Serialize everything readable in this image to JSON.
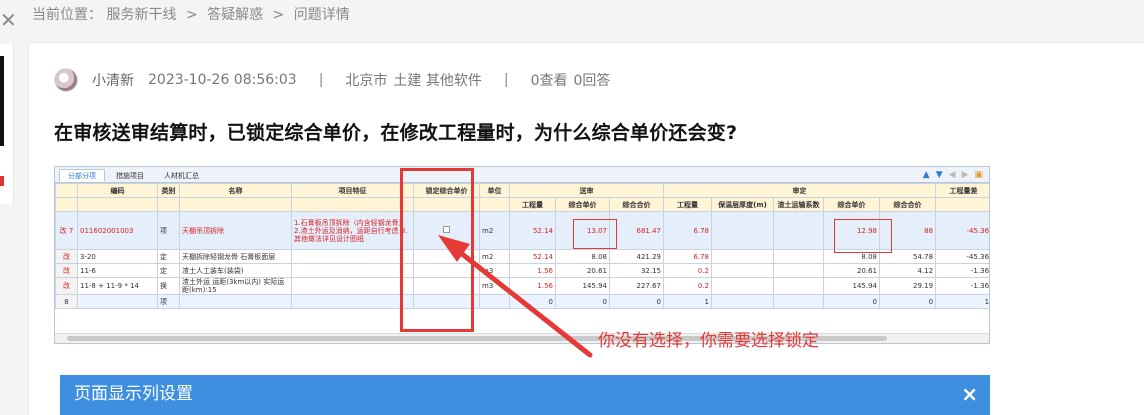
{
  "breadcrumb": {
    "prefix": "当前位置：",
    "items": [
      "服务新干线",
      "答疑解惑",
      "问题详情"
    ],
    "separator": ">"
  },
  "post": {
    "author": "小清新",
    "datetime": "2023-10-26 08:56:03",
    "location": "北京市",
    "category": "土建 其他软件",
    "views": "0查看",
    "answers": "0回答",
    "title": "在审核送审结算时，已锁定综合单价，在修改工程量时，为什么综合单价还会变?"
  },
  "screenshot": {
    "tabs": [
      "分部分项",
      "措施项目",
      "人材机汇总"
    ],
    "headers": {
      "code": "编码",
      "type": "类别",
      "name": "名称",
      "feature": "项目特征",
      "lock": "锁定综合单价",
      "unit": "单位",
      "submit_group": "送审",
      "review_group": "审定",
      "qty": "工程量",
      "unit_price": "综合单价",
      "total": "综合合价",
      "thickness": "保温层厚度(m)",
      "coef": "渣土运输系数",
      "diff": "工程量差"
    },
    "rows": [
      {
        "idx": "改 7",
        "code": "011602001003",
        "type": "项",
        "name": "天棚吊顶拆除",
        "feature": "1.石膏板吊顶拆除（内含轻钢龙骨）2.渣土外运及消纳，运距自行考虑 3.其他做法详见设计图纸",
        "unit": "m2",
        "s_qty": "52.14",
        "s_price": "13.07",
        "s_total": "681.47",
        "r_qty": "6.78",
        "r_thick": "",
        "r_coef": "",
        "r_price": "12.98",
        "r_total": "88",
        "diff": "-45.36"
      },
      {
        "idx": "改",
        "code": "3-20",
        "type": "定",
        "name": "天棚拆除轻钢龙骨 石膏板面层",
        "feature": "",
        "unit": "m2",
        "s_qty": "52.14",
        "s_price": "8.08",
        "s_total": "421.29",
        "r_qty": "6.78",
        "r_thick": "",
        "r_coef": "",
        "r_price": "8.08",
        "r_total": "54.78",
        "diff": "-45.36"
      },
      {
        "idx": "改",
        "code": "11-6",
        "type": "定",
        "name": "渣土人工装车(装袋)",
        "feature": "",
        "unit": "m3",
        "s_qty": "1.56",
        "s_price": "20.61",
        "s_total": "32.15",
        "r_qty": "0.2",
        "r_thick": "",
        "r_coef": "",
        "r_price": "20.61",
        "r_total": "4.12",
        "diff": "-1.36"
      },
      {
        "idx": "改",
        "code": "11-8 + 11-9 * 14",
        "type": "换",
        "name": "渣土外运 运距(3km以内) 实际运距(km):15",
        "feature": "",
        "unit": "m3",
        "s_qty": "1.56",
        "s_price": "145.94",
        "s_total": "227.67",
        "r_qty": "0.2",
        "r_thick": "",
        "r_coef": "",
        "r_price": "145.94",
        "r_total": "29.19",
        "diff": "-1.36"
      },
      {
        "idx": "8",
        "code": "",
        "type": "项",
        "name": "",
        "feature": "",
        "unit": "",
        "s_qty": "0",
        "s_price": "0",
        "s_total": "0",
        "r_qty": "1",
        "r_thick": "",
        "r_coef": "",
        "r_price": "0",
        "r_total": "0",
        "diff": "1"
      }
    ]
  },
  "annotation": {
    "note": "你没有选择，你需要选择锁定",
    "color": "#e53935"
  },
  "dialog": {
    "title": "页面显示列设置",
    "close": "×"
  }
}
